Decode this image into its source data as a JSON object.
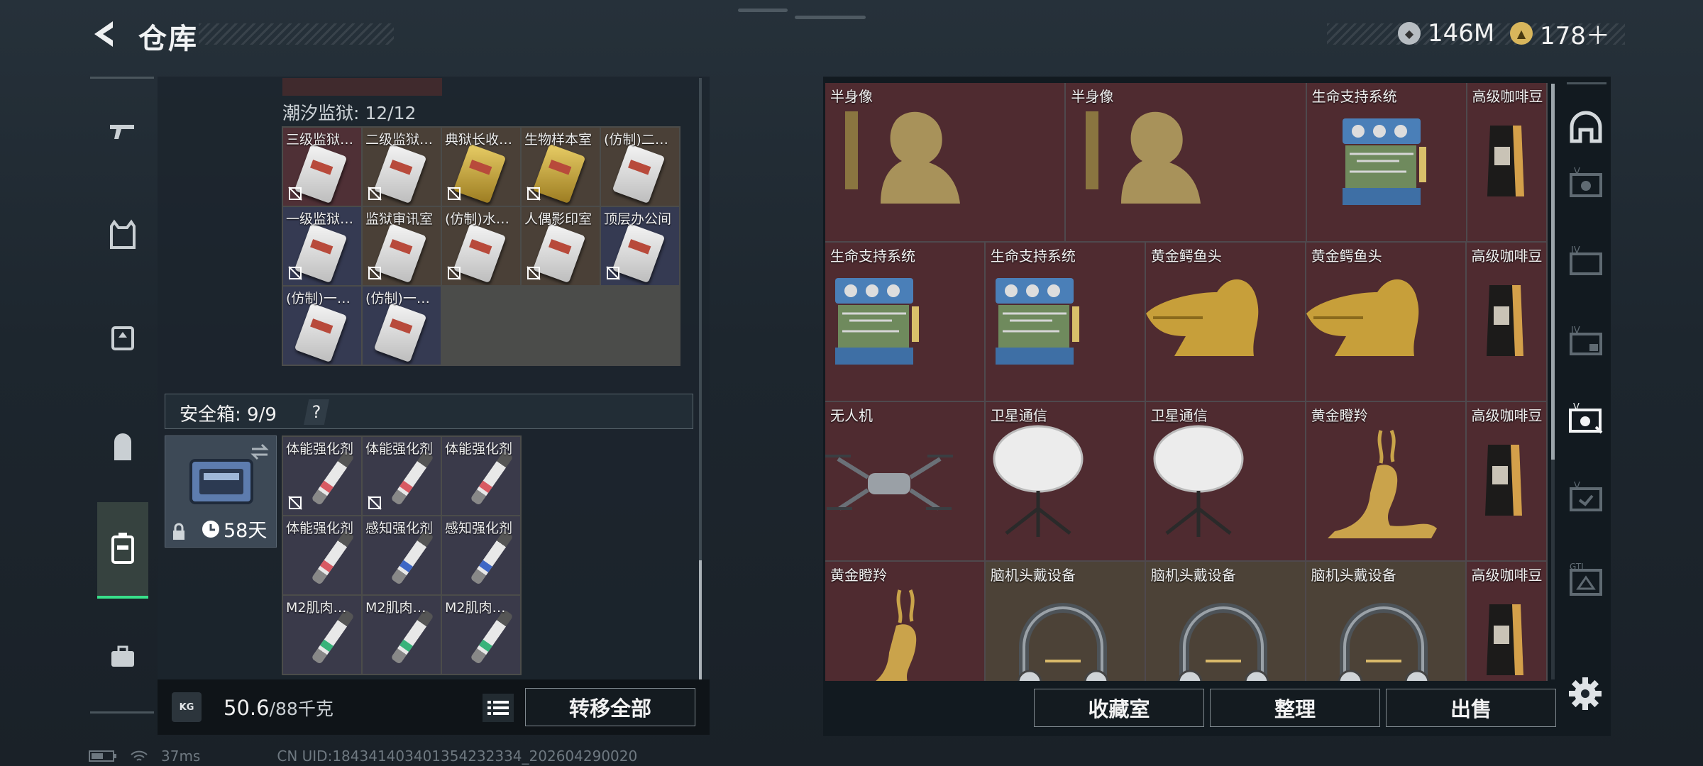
{
  "header": {
    "title": "仓库",
    "currencies": [
      {
        "icon": "silver-coin-icon",
        "value": "146M"
      },
      {
        "icon": "gold-coin-icon",
        "value": "178＋"
      }
    ]
  },
  "left_nav": {
    "items": [
      {
        "icon": "gun-icon"
      },
      {
        "icon": "vest-icon"
      },
      {
        "icon": "chest-rig-icon"
      },
      {
        "icon": "backpack-icon"
      },
      {
        "icon": "secure-case-icon",
        "selected": true
      },
      {
        "icon": "briefcase-icon"
      }
    ]
  },
  "keycards": {
    "section_label": "潮汐监狱: 12/12",
    "items": [
      "三级监狱…",
      "二级监狱…",
      "典狱长收…",
      "生物样本室",
      "(仿制)二…",
      "一级监狱…",
      "监狱审讯室",
      "(仿制)水…",
      "人偶影印室",
      "顶层办公间",
      "(仿制)一…",
      "(仿制)一…"
    ]
  },
  "safe_box": {
    "label": "安全箱: 9/9",
    "help": "?",
    "days": "58天",
    "items": [
      "体能强化剂",
      "体能强化剂",
      "体能强化剂",
      "体能强化剂",
      "感知强化剂",
      "感知强化剂",
      "M2肌肉…",
      "M2肌肉…",
      "M2肌肉…"
    ]
  },
  "weight": {
    "current": "50.6",
    "max": "/88千克",
    "icon_text": "KG"
  },
  "actions": {
    "transfer_all": "转移全部",
    "collection": "收藏室",
    "organize": "整理",
    "sell": "出售"
  },
  "stash": {
    "items": [
      "半身像",
      "半身像",
      "生命支持系统",
      "高级咖啡豆",
      "生命支持系统",
      "生命支持系统",
      "黄金鳄鱼头",
      "黄金鳄鱼头",
      "高级咖啡豆",
      "无人机",
      "卫星通信",
      "卫星通信",
      "黄金瞪羚",
      "高级咖啡豆",
      "黄金瞪羚",
      "脑机头戴设备",
      "脑机头戴设备",
      "脑机头戴设备",
      "高级咖啡豆"
    ]
  },
  "right_nav": {
    "items": [
      {
        "icon": "stash-home-icon"
      },
      {
        "icon": "stash-tab-v-icon"
      },
      {
        "icon": "stash-tab-iv-icon"
      },
      {
        "icon": "stash-tab-iv-b-icon"
      },
      {
        "icon": "stash-tab-v-selected-icon",
        "selected": true
      },
      {
        "icon": "stash-tab-v-b-icon"
      },
      {
        "icon": "stash-tab-gti-icon"
      }
    ]
  },
  "status": {
    "ping": "37ms",
    "uid": "CN UID:1843414034013542323​34_202604290020"
  }
}
